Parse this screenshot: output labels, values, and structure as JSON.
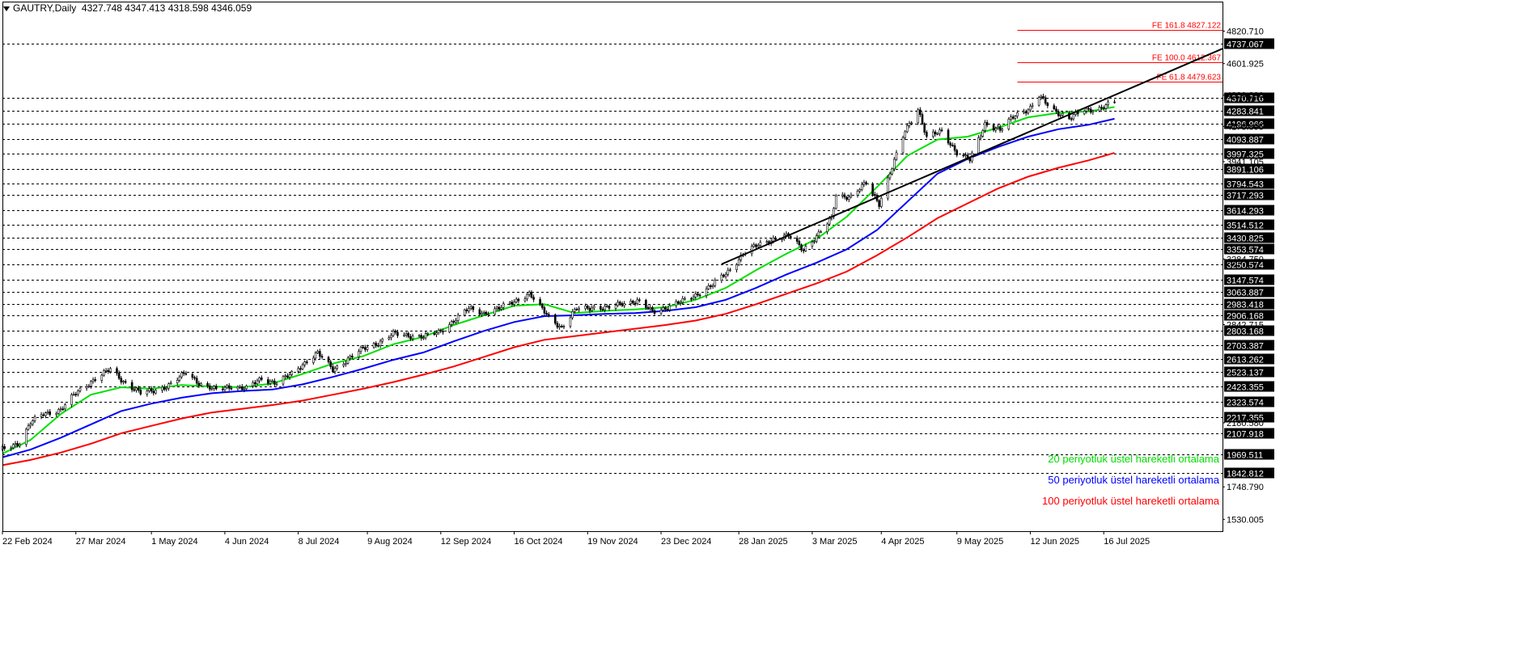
{
  "header": {
    "symbol": "GAUTRY,Daily",
    "ohlc": "4327.748 4347.413 4318.598 4346.059"
  },
  "colors": {
    "background": "#ffffff",
    "candle": "#000000",
    "ema20": "#00e000",
    "ema50": "#0000ff",
    "ema100": "#ff0000",
    "trendline": "#000000",
    "fibo": "#ff0000",
    "level_line": "#000000"
  },
  "chart_data": {
    "type": "line",
    "title": "",
    "x_axis": {
      "labels": [
        "22 Feb 2024",
        "27 Mar 2024",
        "1 May 2024",
        "4 Jun 2024",
        "8 Jul 2024",
        "9 Aug 2024",
        "12 Sep 2024",
        "16 Oct 2024",
        "19 Nov 2024",
        "23 Dec 2024",
        "28 Jan 2025",
        "3 Mar 2025",
        "4 Apr 2025",
        "9 May 2025",
        "12 Jun 2025",
        "16 Jul 2025"
      ],
      "range": [
        "2024-02-22",
        "2025-09-09"
      ]
    },
    "y_axis": {
      "range": [
        1450,
        5020
      ],
      "scale_labels": [
        4820.71,
        4601.925,
        4389.89,
        4178.895,
        3941.105,
        3284.75,
        2842.715,
        2180.58,
        1748.79,
        1530.005
      ]
    },
    "horizontal_levels": [
      4737.067,
      4370.716,
      4283.841,
      4196.966,
      4093.887,
      3997.325,
      3891.106,
      3794.543,
      3717.293,
      3614.293,
      3514.512,
      3430.825,
      3353.574,
      3250.574,
      3147.574,
      3063.887,
      2983.418,
      2906.168,
      2803.168,
      2703.387,
      2613.262,
      2523.137,
      2423.355,
      2323.574,
      2217.355,
      2107.918,
      1969.511,
      1842.812
    ],
    "fibonacci_levels": [
      {
        "label": "FE 161.8 4827.122",
        "value": 4827.122
      },
      {
        "label": "FE 100.0 4612.367",
        "value": 4612.367
      },
      {
        "label": "FE 61.8 4479.623",
        "value": 4479.623
      }
    ],
    "fibonacci_start": "2025-06-06",
    "trendline": {
      "points": [
        [
          "2025-01-20",
          3250
        ],
        [
          "2025-08-14",
          4540
        ]
      ]
    },
    "series": [
      {
        "name": "20 periyotluk üstel hareketli ortalama",
        "key": "ema20",
        "points": [
          [
            "2024-02-22",
            1972
          ],
          [
            "2024-03-06",
            2065
          ],
          [
            "2024-03-20",
            2240
          ],
          [
            "2024-04-03",
            2370
          ],
          [
            "2024-04-17",
            2420
          ],
          [
            "2024-05-01",
            2410
          ],
          [
            "2024-05-15",
            2435
          ],
          [
            "2024-05-29",
            2425
          ],
          [
            "2024-06-12",
            2420
          ],
          [
            "2024-06-26",
            2445
          ],
          [
            "2024-07-10",
            2510
          ],
          [
            "2024-07-24",
            2580
          ],
          [
            "2024-08-07",
            2630
          ],
          [
            "2024-08-21",
            2710
          ],
          [
            "2024-09-04",
            2760
          ],
          [
            "2024-09-18",
            2840
          ],
          [
            "2024-10-02",
            2905
          ],
          [
            "2024-10-16",
            2970
          ],
          [
            "2024-10-30",
            2980
          ],
          [
            "2024-11-13",
            2920
          ],
          [
            "2024-11-27",
            2935
          ],
          [
            "2024-12-11",
            2945
          ],
          [
            "2024-12-25",
            2960
          ],
          [
            "2025-01-08",
            3010
          ],
          [
            "2025-01-22",
            3090
          ],
          [
            "2025-02-05",
            3210
          ],
          [
            "2025-02-19",
            3320
          ],
          [
            "2025-03-05",
            3420
          ],
          [
            "2025-03-19",
            3570
          ],
          [
            "2025-04-02",
            3770
          ],
          [
            "2025-04-16",
            3980
          ],
          [
            "2025-04-30",
            4090
          ],
          [
            "2025-05-14",
            4110
          ],
          [
            "2025-05-28",
            4170
          ],
          [
            "2025-06-11",
            4240
          ],
          [
            "2025-06-25",
            4270
          ],
          [
            "2025-07-09",
            4280
          ],
          [
            "2025-07-21",
            4310
          ]
        ]
      },
      {
        "name": "50 periyotluk üstel hareketli ortalama",
        "key": "ema50",
        "points": [
          [
            "2024-02-22",
            1948
          ],
          [
            "2024-03-06",
            2000
          ],
          [
            "2024-03-20",
            2080
          ],
          [
            "2024-04-03",
            2170
          ],
          [
            "2024-04-17",
            2260
          ],
          [
            "2024-05-01",
            2310
          ],
          [
            "2024-05-15",
            2350
          ],
          [
            "2024-05-29",
            2380
          ],
          [
            "2024-06-12",
            2395
          ],
          [
            "2024-06-26",
            2405
          ],
          [
            "2024-07-10",
            2440
          ],
          [
            "2024-07-24",
            2490
          ],
          [
            "2024-08-07",
            2545
          ],
          [
            "2024-08-21",
            2605
          ],
          [
            "2024-09-04",
            2655
          ],
          [
            "2024-09-18",
            2730
          ],
          [
            "2024-10-02",
            2800
          ],
          [
            "2024-10-16",
            2860
          ],
          [
            "2024-10-30",
            2900
          ],
          [
            "2024-11-13",
            2905
          ],
          [
            "2024-11-27",
            2915
          ],
          [
            "2024-12-11",
            2920
          ],
          [
            "2024-12-25",
            2935
          ],
          [
            "2025-01-08",
            2960
          ],
          [
            "2025-01-22",
            3010
          ],
          [
            "2025-02-05",
            3090
          ],
          [
            "2025-02-19",
            3180
          ],
          [
            "2025-03-05",
            3260
          ],
          [
            "2025-03-19",
            3350
          ],
          [
            "2025-04-02",
            3480
          ],
          [
            "2025-04-16",
            3670
          ],
          [
            "2025-04-30",
            3860
          ],
          [
            "2025-05-14",
            3960
          ],
          [
            "2025-05-28",
            4040
          ],
          [
            "2025-06-11",
            4110
          ],
          [
            "2025-06-25",
            4160
          ],
          [
            "2025-07-09",
            4190
          ],
          [
            "2025-07-21",
            4230
          ]
        ]
      },
      {
        "name": "100 periyotluk üstel hareketli ortalama",
        "key": "ema100",
        "points": [
          [
            "2024-02-22",
            1895
          ],
          [
            "2024-03-06",
            1930
          ],
          [
            "2024-03-20",
            1980
          ],
          [
            "2024-04-03",
            2040
          ],
          [
            "2024-04-17",
            2110
          ],
          [
            "2024-05-01",
            2160
          ],
          [
            "2024-05-15",
            2210
          ],
          [
            "2024-05-29",
            2250
          ],
          [
            "2024-06-12",
            2275
          ],
          [
            "2024-06-26",
            2300
          ],
          [
            "2024-07-10",
            2330
          ],
          [
            "2024-07-24",
            2370
          ],
          [
            "2024-08-07",
            2410
          ],
          [
            "2024-08-21",
            2455
          ],
          [
            "2024-09-04",
            2505
          ],
          [
            "2024-09-18",
            2560
          ],
          [
            "2024-10-02",
            2625
          ],
          [
            "2024-10-16",
            2690
          ],
          [
            "2024-10-30",
            2740
          ],
          [
            "2024-11-13",
            2765
          ],
          [
            "2024-11-27",
            2790
          ],
          [
            "2024-12-11",
            2815
          ],
          [
            "2024-12-25",
            2840
          ],
          [
            "2025-01-08",
            2870
          ],
          [
            "2025-01-22",
            2915
          ],
          [
            "2025-02-05",
            2980
          ],
          [
            "2025-02-19",
            3050
          ],
          [
            "2025-03-05",
            3120
          ],
          [
            "2025-03-19",
            3200
          ],
          [
            "2025-04-02",
            3310
          ],
          [
            "2025-04-16",
            3430
          ],
          [
            "2025-04-30",
            3560
          ],
          [
            "2025-05-14",
            3660
          ],
          [
            "2025-05-28",
            3760
          ],
          [
            "2025-06-11",
            3840
          ],
          [
            "2025-06-25",
            3900
          ],
          [
            "2025-07-09",
            3950
          ],
          [
            "2025-07-21",
            4000
          ]
        ]
      },
      {
        "name": "Price",
        "key": "price",
        "points": [
          [
            "2024-02-22",
            2000
          ],
          [
            "2024-03-01",
            2050
          ],
          [
            "2024-03-06",
            2180
          ],
          [
            "2024-03-12",
            2240
          ],
          [
            "2024-03-20",
            2270
          ],
          [
            "2024-03-27",
            2380
          ],
          [
            "2024-04-05",
            2480
          ],
          [
            "2024-04-12",
            2540
          ],
          [
            "2024-04-18",
            2460
          ],
          [
            "2024-04-26",
            2380
          ],
          [
            "2024-05-03",
            2400
          ],
          [
            "2024-05-10",
            2440
          ],
          [
            "2024-05-17",
            2520
          ],
          [
            "2024-05-24",
            2440
          ],
          [
            "2024-05-31",
            2400
          ],
          [
            "2024-06-07",
            2430
          ],
          [
            "2024-06-14",
            2410
          ],
          [
            "2024-06-21",
            2480
          ],
          [
            "2024-06-28",
            2450
          ],
          [
            "2024-07-05",
            2510
          ],
          [
            "2024-07-12",
            2600
          ],
          [
            "2024-07-17",
            2650
          ],
          [
            "2024-07-24",
            2540
          ],
          [
            "2024-07-31",
            2610
          ],
          [
            "2024-08-07",
            2680
          ],
          [
            "2024-08-14",
            2720
          ],
          [
            "2024-08-21",
            2780
          ],
          [
            "2024-08-28",
            2770
          ],
          [
            "2024-09-04",
            2760
          ],
          [
            "2024-09-11",
            2790
          ],
          [
            "2024-09-18",
            2870
          ],
          [
            "2024-09-25",
            2950
          ],
          [
            "2024-10-02",
            2920
          ],
          [
            "2024-10-09",
            2950
          ],
          [
            "2024-10-16",
            3000
          ],
          [
            "2024-10-23",
            3050
          ],
          [
            "2024-10-28",
            2960
          ],
          [
            "2024-11-01",
            2900
          ],
          [
            "2024-11-07",
            2820
          ],
          [
            "2024-11-14",
            2950
          ],
          [
            "2024-11-21",
            2960
          ],
          [
            "2024-11-28",
            2950
          ],
          [
            "2024-12-05",
            2990
          ],
          [
            "2024-12-12",
            3000
          ],
          [
            "2024-12-19",
            2930
          ],
          [
            "2024-12-26",
            2960
          ],
          [
            "2025-01-02",
            3000
          ],
          [
            "2025-01-09",
            3050
          ],
          [
            "2025-01-16",
            3110
          ],
          [
            "2025-01-23",
            3200
          ],
          [
            "2025-01-30",
            3320
          ],
          [
            "2025-02-06",
            3380
          ],
          [
            "2025-02-13",
            3420
          ],
          [
            "2025-02-20",
            3440
          ],
          [
            "2025-02-27",
            3350
          ],
          [
            "2025-03-06",
            3450
          ],
          [
            "2025-03-12",
            3560
          ],
          [
            "2025-03-14",
            3720
          ],
          [
            "2025-03-21",
            3700
          ],
          [
            "2025-03-28",
            3800
          ],
          [
            "2025-04-03",
            3660
          ],
          [
            "2025-04-09",
            3900
          ],
          [
            "2025-04-15",
            4150
          ],
          [
            "2025-04-21",
            4300
          ],
          [
            "2025-04-25",
            4100
          ],
          [
            "2025-05-02",
            4150
          ],
          [
            "2025-05-09",
            4000
          ],
          [
            "2025-05-15",
            3950
          ],
          [
            "2025-05-22",
            4200
          ],
          [
            "2025-05-29",
            4150
          ],
          [
            "2025-06-05",
            4260
          ],
          [
            "2025-06-12",
            4300
          ],
          [
            "2025-06-16",
            4380
          ],
          [
            "2025-06-23",
            4290
          ],
          [
            "2025-06-30",
            4230
          ],
          [
            "2025-07-07",
            4290
          ],
          [
            "2025-07-14",
            4300
          ],
          [
            "2025-07-21",
            4340
          ]
        ]
      }
    ],
    "legend": {
      "placement": "bottom-right"
    },
    "grid": false
  }
}
